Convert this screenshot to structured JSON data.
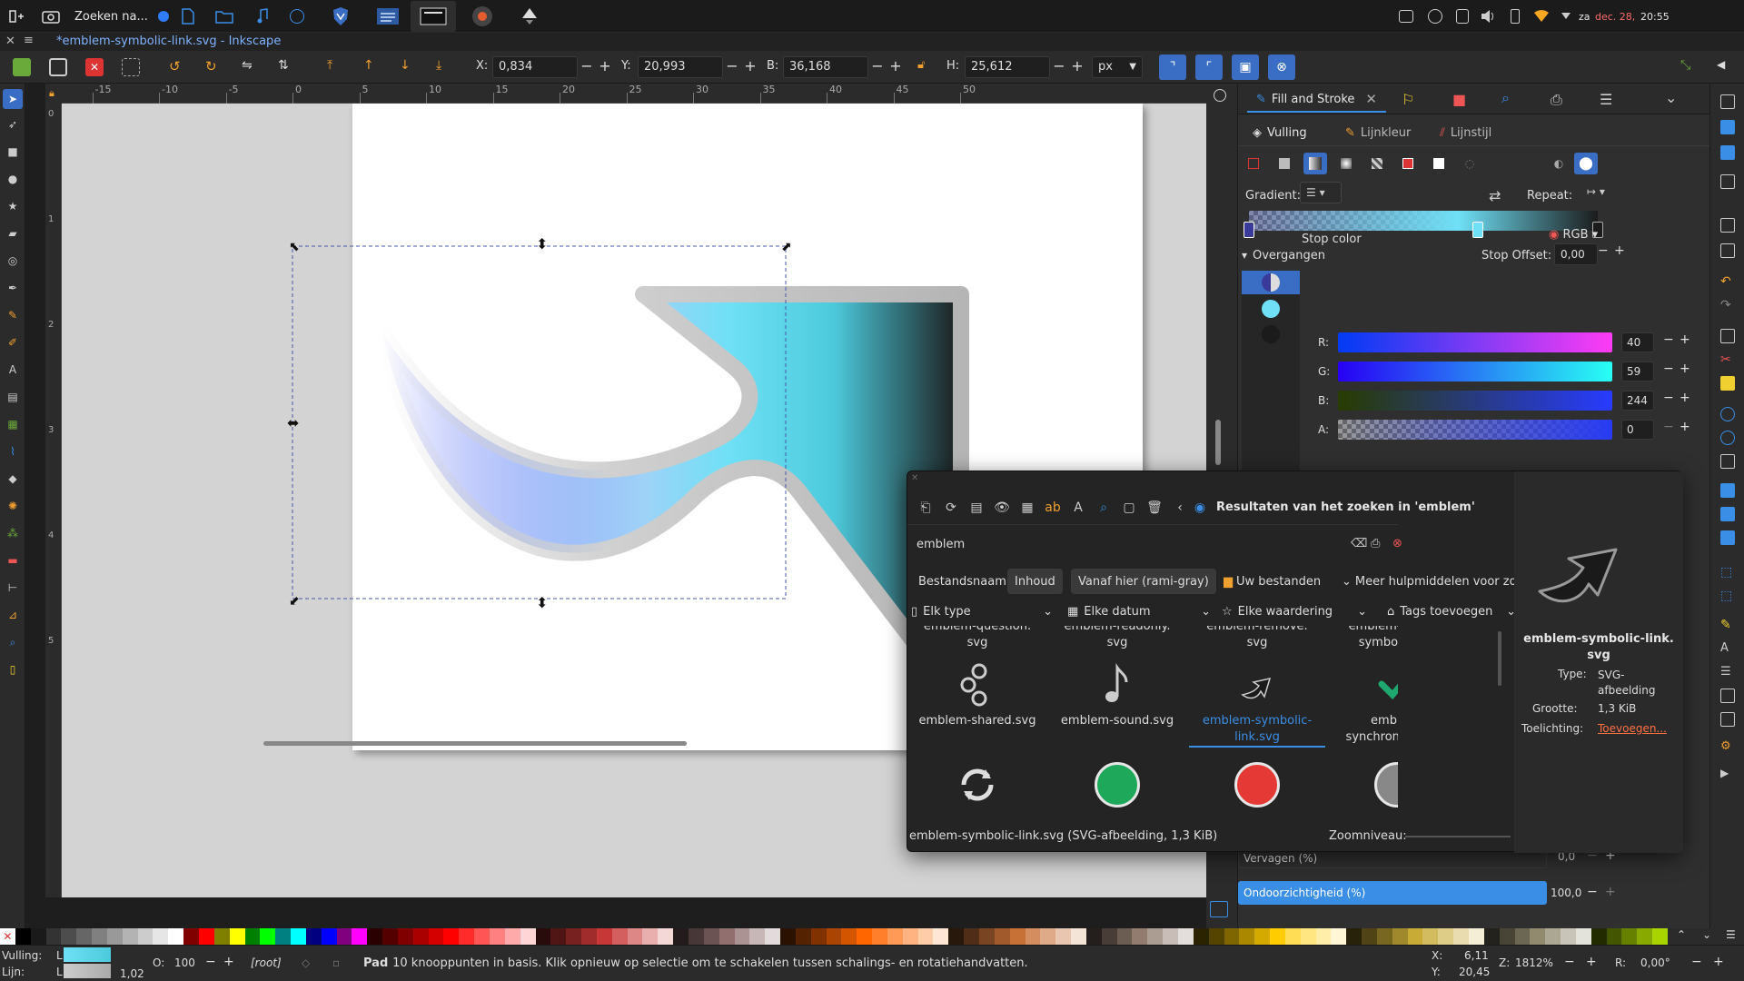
{
  "taskbar": {
    "search_label": "Zoeken na...",
    "date_label": "za",
    "date_value": "dec. 28,",
    "time": "20:55"
  },
  "titlebar": {
    "title": "*emblem-symbolic-link.svg - Inkscape"
  },
  "toolctrl": {
    "x_label": "X:",
    "x_value": "0,834",
    "y_label": "Y:",
    "y_value": "20,993",
    "w_label": "B:",
    "w_value": "36,168",
    "h_label": "H:",
    "h_value": "25,612",
    "unit": "px"
  },
  "hruler": {
    "ticks": [
      "-15",
      "-10",
      "-5",
      "0",
      "5",
      "10",
      "15",
      "20",
      "25",
      "30",
      "35",
      "40",
      "45",
      "50"
    ]
  },
  "vruler": {
    "ticks": [
      "0",
      "1",
      "2",
      "3",
      "4",
      "5"
    ]
  },
  "dock": {
    "tab_title": "Fill and Stroke",
    "sub_fill": "Vulling",
    "sub_stroke_paint": "Lijnkleur",
    "sub_stroke_style": "Lijnstijl",
    "gradient_label": "Gradient:",
    "repeat_label": "Repeat:",
    "stops_label": "Overgangen",
    "stop_offset_label": "Stop Offset:",
    "stop_offset_value": "0,00",
    "stop_color_label": "Stop color",
    "color_mode": "RGB",
    "r_label": "R:",
    "r_value": "40",
    "g_label": "G:",
    "g_value": "59",
    "b_label": "B:",
    "b_value": "244",
    "a_label": "A:",
    "a_value": "0",
    "blur_label": "Vervagen (%)",
    "blur_value": "0,0",
    "opacity_label": "Ondoorzichtigheid (%)",
    "opacity_value": "100,0"
  },
  "chooser": {
    "title": "Resultaten van het zoeken in 'emblem'",
    "search_value": "emblem",
    "scope_filename": "Bestandsnaam",
    "scope_content": "Inhoud",
    "scope_here": "Vanaf hier (rami-gray)",
    "scope_your_files": "Uw bestanden",
    "more_tools": "Meer hulpmiddelen voor zoe",
    "filter_type": "Elk type",
    "filter_date": "Elke datum",
    "filter_rating": "Elke waardering",
    "filter_tags": "Tags toevoegen",
    "row0": [
      {
        "line1": "emblem-question.",
        "line2": "svg"
      },
      {
        "line1": "emblem-readonly.",
        "line2": "svg"
      },
      {
        "line1": "emblem-remove.",
        "line2": "svg"
      },
      {
        "line1": "emblem-shared-",
        "line2": "symbolic.svg"
      }
    ],
    "row1": [
      {
        "line1": "emblem-shared.svg",
        "line2": ""
      },
      {
        "line1": "emblem-sound.svg",
        "line2": ""
      },
      {
        "line1": "emblem-symbolic-",
        "line2": "link.svg"
      },
      {
        "line1": "emblem-",
        "line2": "synchronized.svg"
      }
    ],
    "status_text": "emblem-symbolic-link.svg (SVG-afbeelding, 1,3 KiB)",
    "zoom_label": "Zoomniveau:",
    "preview_name_line1": "emblem-symbolic-link.",
    "preview_name_line2": "svg",
    "type_label": "Type:",
    "type_value_line1": "SVG-",
    "type_value_line2": "afbeelding",
    "size_label": "Grootte:",
    "size_value": "1,3 KiB",
    "comment_label": "Toelichting:",
    "comment_value": "Toevoegen..."
  },
  "status": {
    "fill_label": "Vulling:",
    "fill_value": "L",
    "stroke_label": "Lijn:",
    "stroke_value": "L",
    "stroke_width": "1,02",
    "opacity_label": "O:",
    "opacity_value": "100",
    "layer": "[root]",
    "message_bold": "Pad",
    "message": " 10 knooppunten in basis. Klik opnieuw op selectie om te schakelen tussen schalings- en rotatiehandvatten.",
    "cursor_x_label": "X:",
    "cursor_x": "6,11",
    "cursor_y_label": "Y:",
    "cursor_y": "20,45",
    "zoom_label": "Z:",
    "zoom_value": "1812%",
    "rotate_label": "R:",
    "rotate_value": "0,00°"
  },
  "palette": [
    "#000000",
    "#1a1a1a",
    "#333333",
    "#4d4d4d",
    "#666666",
    "#808080",
    "#999999",
    "#b3b3b3",
    "#cccccc",
    "#e6e6e6",
    "#ffffff",
    "#800000",
    "#ff0000",
    "#808000",
    "#ffff00",
    "#008000",
    "#00ff00",
    "#008080",
    "#00ffff",
    "#000080",
    "#0000ff",
    "#800080",
    "#ff00ff",
    "#2b0000",
    "#550000",
    "#800000",
    "#aa0000",
    "#d40000",
    "#ff0000",
    "#ff2a2a",
    "#ff5555",
    "#ff8080",
    "#ffaaaa",
    "#ffd5d5",
    "#280b0b",
    "#501616",
    "#782121",
    "#a02c2c",
    "#c83737",
    "#d35f5f",
    "#de8787",
    "#e9afaf",
    "#f4d7d7",
    "#241c1c",
    "#483737",
    "#6c5353",
    "#916f6f",
    "#ac9393",
    "#c8b7b7",
    "#e3dbdb",
    "#2b1100",
    "#552200",
    "#803300",
    "#aa4400",
    "#d45500",
    "#ff6600",
    "#ff7f2a",
    "#ff9955",
    "#ffb380",
    "#ffccaa",
    "#ffe6d5",
    "#28170b",
    "#502d16",
    "#784421",
    "#a05a2c",
    "#c87137",
    "#d38d5f",
    "#deaa87",
    "#e9c6af",
    "#f4e3d7",
    "#241f1c",
    "#483e37",
    "#6c5d53",
    "#917c6f",
    "#ac9d93",
    "#c8beb7",
    "#e3dedb",
    "#2b2200",
    "#554400",
    "#806600",
    "#aa8800",
    "#d4aa00",
    "#ffcc00",
    "#ffdd55",
    "#ffe680",
    "#ffeeaa",
    "#fff6d5",
    "#28220b",
    "#504416",
    "#786721",
    "#a0892c",
    "#c8ab37",
    "#d3bc5f",
    "#decd87",
    "#e9ddaf",
    "#f4eed7",
    "#24221c",
    "#484537",
    "#6c6753",
    "#918a6f",
    "#aca793",
    "#c8c4b7",
    "#e3e2db",
    "#222b00",
    "#445500",
    "#668000",
    "#88aa00",
    "#aad400"
  ]
}
